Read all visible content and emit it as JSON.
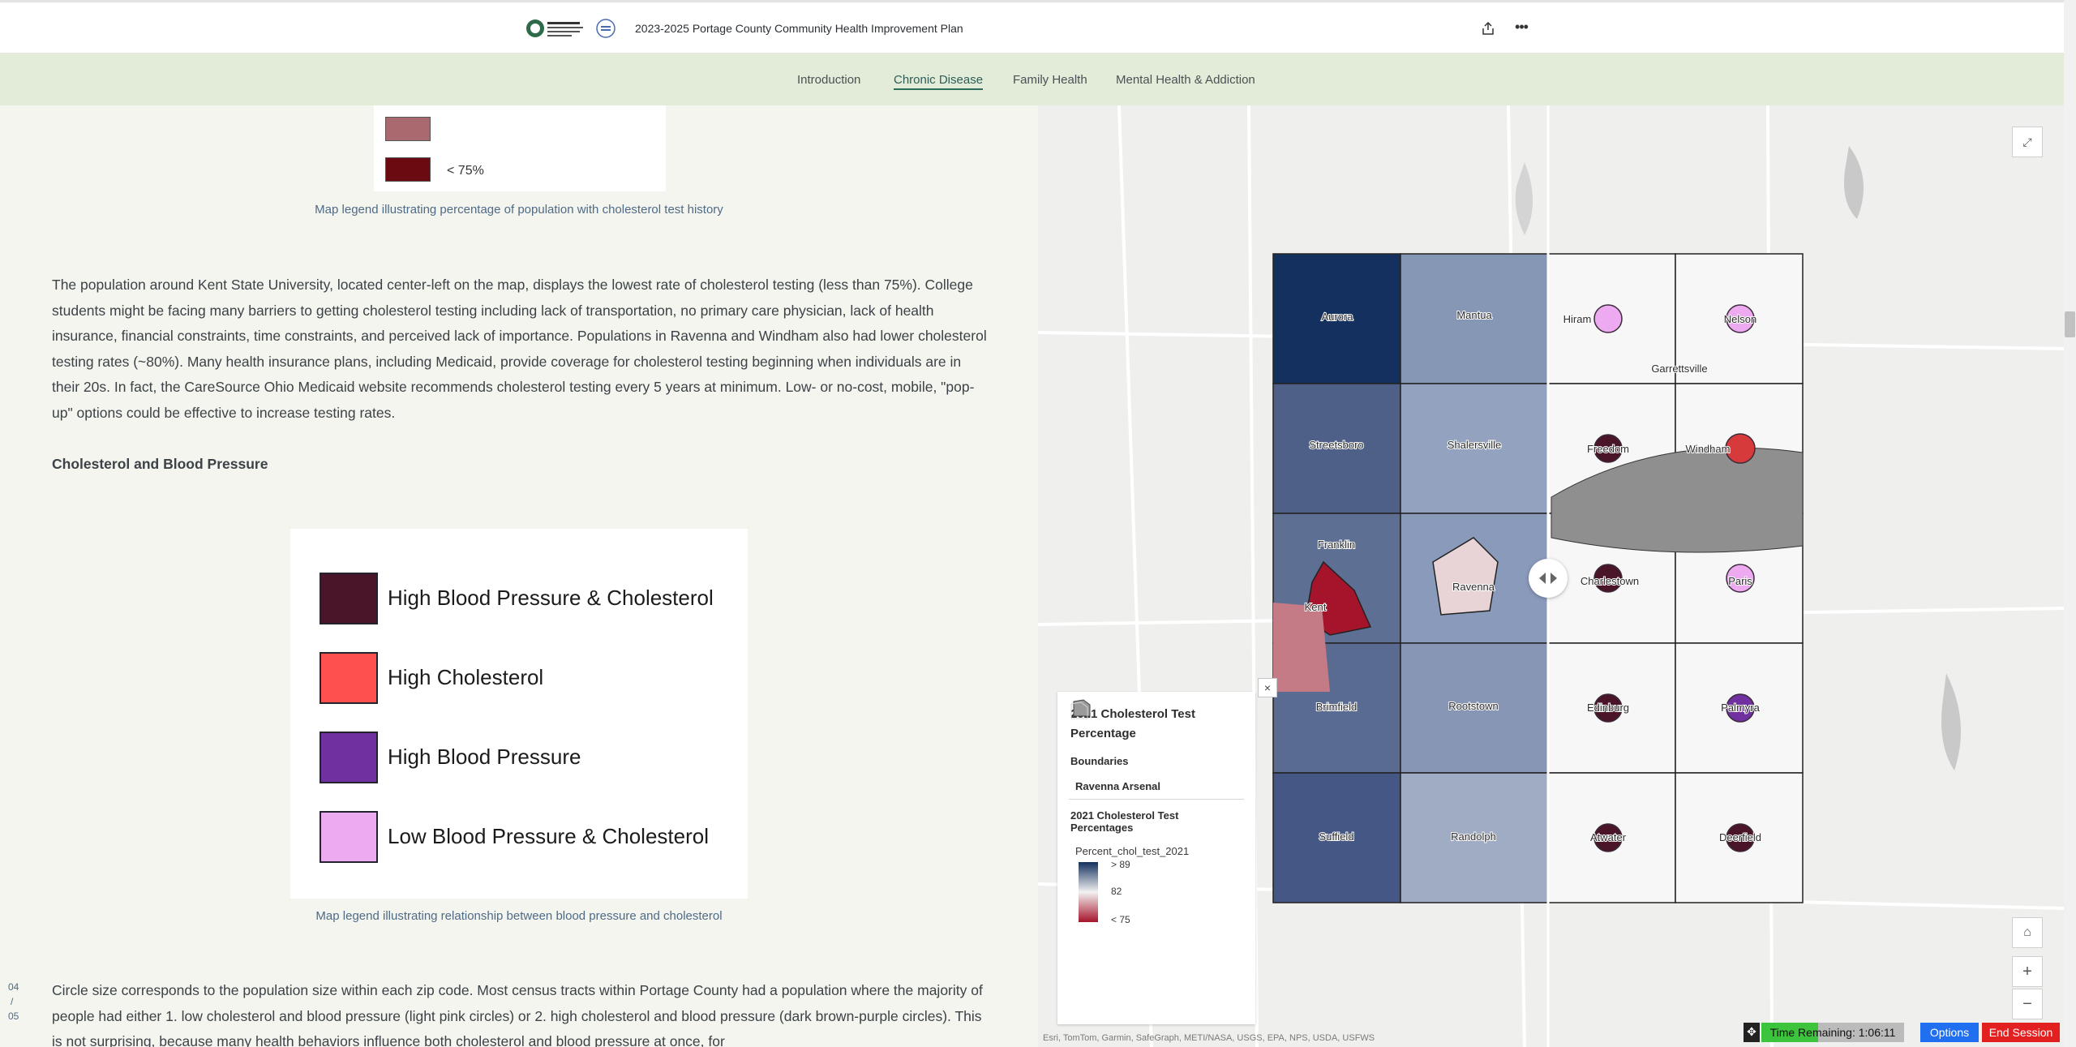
{
  "header": {
    "title": "2023-2025 Portage County Community Health Improvement Plan",
    "logo_text": "PORTAGE COUNTY COMBINED GENERAL HEALTH DISTRICT"
  },
  "nav": {
    "items": [
      "Introduction",
      "Chronic Disease",
      "Family Health",
      "Mental Health & Addiction"
    ],
    "active": "Chronic Disease"
  },
  "legend1": {
    "colors": [
      "#a86a6f",
      "#6b0a10"
    ],
    "last_label": "< 75%"
  },
  "content": {
    "caption1": "Map legend illustrating percentage of population with cholesterol test history",
    "para1": "The population around Kent State University, located center-left on the map, displays the lowest rate of cholesterol testing (less than 75%). College students might be facing many barriers to getting cholesterol testing including lack of transportation, no primary care physician, lack of health insurance, financial constraints, time constraints, and perceived lack of importance. Populations in Ravenna and Windham also had lower cholesterol testing rates (~80%). Many health insurance plans, including Medicaid, provide coverage for cholesterol testing beginning when individuals are in their 20s. In fact, the CareSource Ohio Medicaid website recommends cholesterol testing every 5 years at minimum. Low- or no-cost, mobile, \"pop-up\" options could be effective to increase testing rates.",
    "subhead": "Cholesterol and Blood Pressure",
    "caption2": "Map legend illustrating relationship between blood pressure and cholesterol",
    "para2": "Circle size corresponds to the population size within each zip code. Most census tracts within Portage County had a population where the majority of people had either 1. low cholesterol and blood pressure (light pink circles) or 2. high cholesterol and blood pressure (dark brown-purple circles). This is not surprising, because many health behaviors influence both cholesterol and blood pressure at once, for"
  },
  "legend2": {
    "items": [
      {
        "label": "High Blood Pressure & Cholesterol",
        "color": "#4a1429"
      },
      {
        "label": "High Cholesterol",
        "color": "#ff5050"
      },
      {
        "label": "High Blood Pressure",
        "color": "#7030a0"
      },
      {
        "label": "Low Blood Pressure & Cholesterol",
        "color": "#eeaaf0"
      }
    ]
  },
  "pager": {
    "current": "04",
    "sep": "/",
    "total": "05"
  },
  "map": {
    "townships_left": [
      {
        "name": "Aurora",
        "color": "#13305e"
      },
      {
        "name": "Mantua",
        "color": "#8696b5"
      },
      {
        "name": "Streetsboro",
        "color": "#4e6088"
      },
      {
        "name": "Shalersville",
        "color": "#93a2be"
      },
      {
        "name": "Franklin",
        "color": "#5e6f94"
      },
      {
        "name": "Kent",
        "color": "#a5142a"
      },
      {
        "name": "Ravenna",
        "color": "#e8d4d7"
      },
      {
        "name": "Brimfield",
        "color": "#5a6b91"
      },
      {
        "name": "Rootstown",
        "color": "#8796b4"
      },
      {
        "name": "Suffield",
        "color": "#455785"
      },
      {
        "name": "Randolph",
        "color": "#a0acc4"
      }
    ],
    "townships_right": [
      {
        "name": "Hiram",
        "circle": "#eeaaf0"
      },
      {
        "name": "Nelson",
        "circle": "#eeaaf0"
      },
      {
        "name": "Garrettsville",
        "circle": ""
      },
      {
        "name": "Freedom",
        "circle": "#4a1429"
      },
      {
        "name": "Windham",
        "circle": "#d63a3a"
      },
      {
        "name": "Charlestown",
        "circle": "#4a1429"
      },
      {
        "name": "Paris",
        "circle": "#eeaaf0"
      },
      {
        "name": "Edinburg",
        "circle": "#4a1429"
      },
      {
        "name": "Palmyra",
        "circle": "#7030a0"
      },
      {
        "name": "Atwater",
        "circle": "#4a1429"
      },
      {
        "name": "Deerfield",
        "circle": "#4a1429"
      }
    ],
    "legend": {
      "title": "2021 Cholesterol Test Percentage",
      "boundaries": "Boundaries",
      "arsenal": "Ravenna Arsenal",
      "layer": "2021 Cholesterol Test Percentages",
      "field": "Percent_chol_test_2021",
      "ramp": [
        "> 89",
        "82",
        "< 75"
      ]
    },
    "attribution": "Esri, TomTom, Garmin, SafeGraph, METI/NASA, USGS, EPA, NPS, USDA, USFWS"
  },
  "session": {
    "time": "Time Remaining: 1:06:11",
    "time_fraction": 0.4,
    "options": "Options",
    "end": "End Session"
  }
}
